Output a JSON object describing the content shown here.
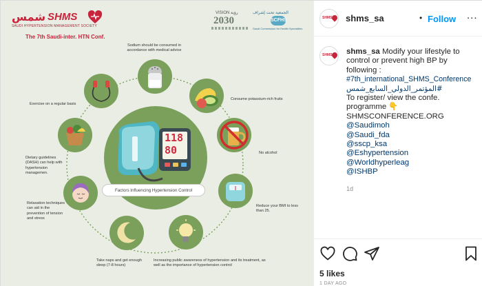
{
  "post": {
    "account": "shms_sa",
    "follow_label": "Follow",
    "more_label": "...",
    "avatar_text": "SHMS",
    "caption": {
      "username": "shms_sa",
      "lines": [
        "Modify your lifestyle to",
        "control or prevent high BP by",
        "following :",
        "#7th_international_SHMS_Conference",
        "المؤتمر_الدولي_السابع_شمس#",
        "To register/ view the confe.",
        "programme 👇",
        "SHMSCONFERENCE.ORG",
        "@Saudimoh",
        "@Saudi_fda",
        "@sscp_ksa",
        "@Eshypertension",
        "@Worldhyperleag",
        "@ISHBP"
      ]
    },
    "time_posted": "1d",
    "likes": "5 likes",
    "time_ago": "1 DAY AGO"
  },
  "infographic": {
    "logo": {
      "arabic": "شمس",
      "english": "SHMS",
      "society": "SAUDI HYPERTENSION MANAGEMENT SOCIETY",
      "conference": "The 7th Saudi-inter. HTN Conf."
    },
    "vision": {
      "top": "VISION رؤية",
      "year": "2030"
    },
    "scfhs": {
      "arabic": "الجمعية تحت إشراف",
      "badge": "SCFHS",
      "english": "Saudi Commission for Health Specialties"
    },
    "center_label": "Factors Influencing Hypertension Control",
    "monitor": {
      "top": "118",
      "bottom": "80"
    },
    "factors": [
      "Sodium should be consumed in accordance with medical advice",
      "Consume potassium-rich fruits",
      "No alcohol",
      "Reduce your BMI to less than 25.",
      "Increasing public awareness of hypertension and its treatment, as well as the importance of hypertension control",
      "Take naps and get enough sleep (7-8 hours)",
      "Relaxation techniques can aid in the prevention of tension and stress",
      "Dietary guidelines (DASH) can help with hypertension managemen.",
      "Exercise on a regular basis"
    ]
  },
  "colors": {
    "green": "#7aa05b",
    "brand_red": "#c8243b",
    "link_blue": "#0095f6",
    "tag_blue": "#00376b",
    "media_bg": "#e9ede3"
  },
  "icons": [
    "more-options-icon",
    "heart-icon",
    "comment-icon",
    "share-icon",
    "bookmark-icon"
  ]
}
